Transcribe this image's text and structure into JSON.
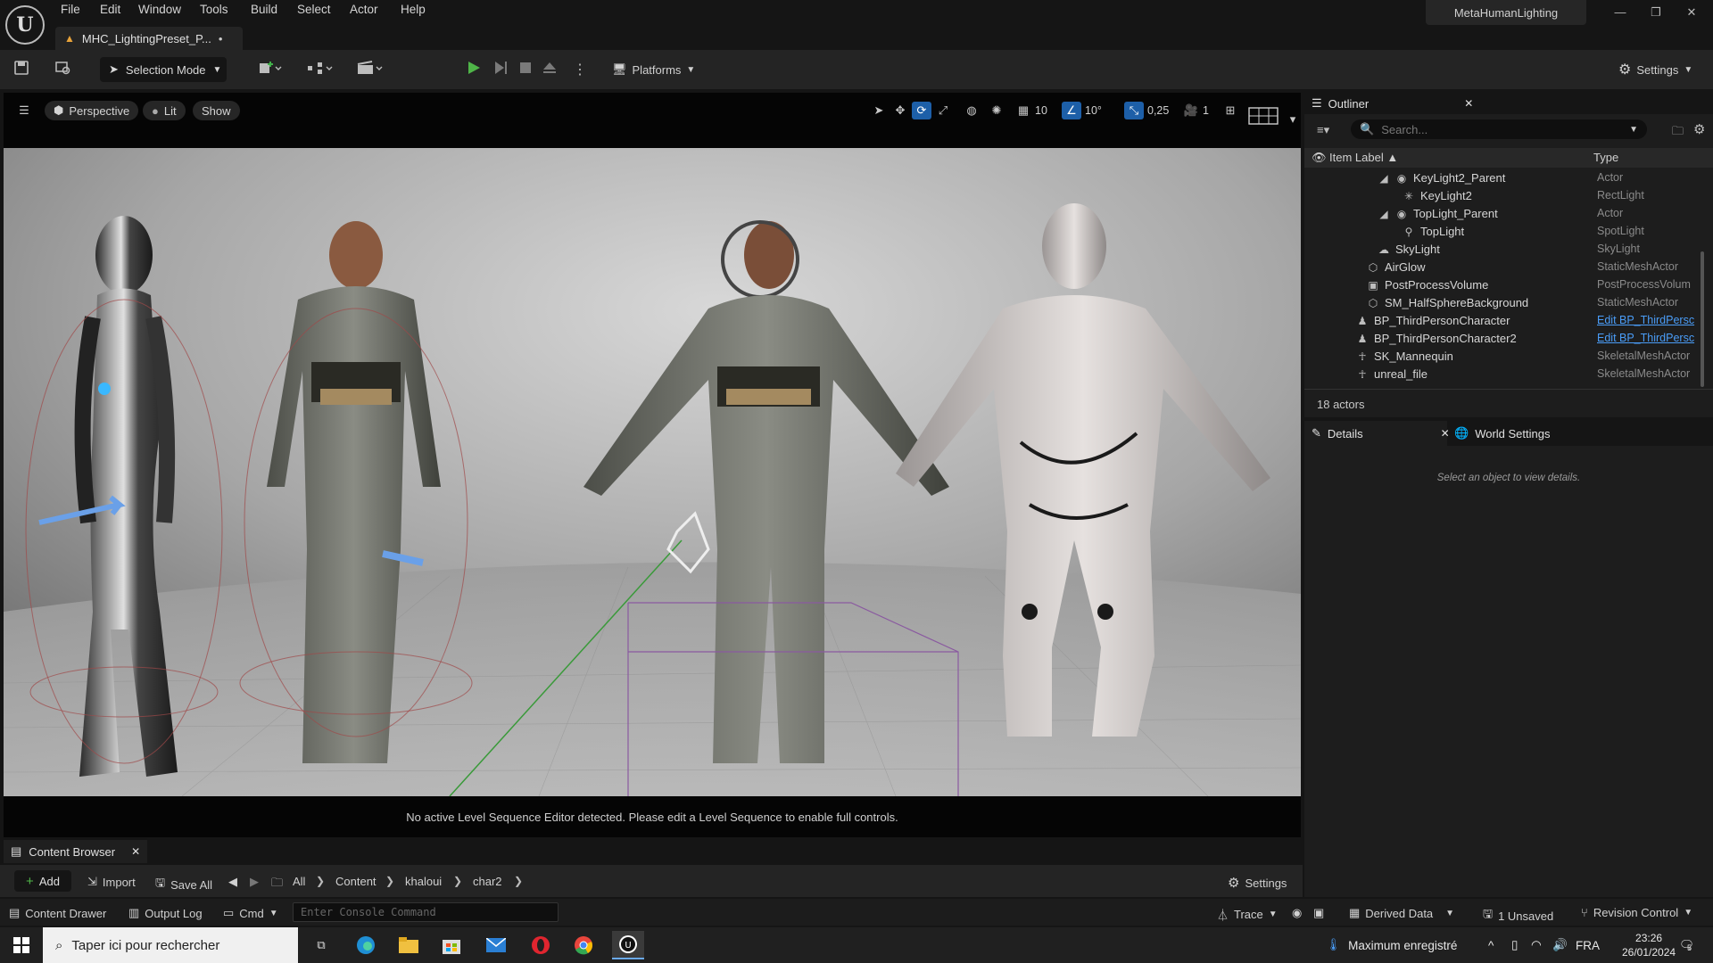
{
  "menu": [
    "File",
    "Edit",
    "Window",
    "Tools",
    "Build",
    "Select",
    "Actor",
    "Help"
  ],
  "doc_tab": {
    "title": "MHC_LightingPreset_P...",
    "modified_marker": "•"
  },
  "project_name": "MetaHumanLighting",
  "toolbar": {
    "selection_mode": "Selection Mode",
    "platforms": "Platforms",
    "settings": "Settings"
  },
  "viewport": {
    "perspective": "Perspective",
    "lit": "Lit",
    "show": "Show",
    "grid_snap": "10",
    "rotation_snap": "10°",
    "scale_snap": "0,25",
    "camera_speed": "1",
    "sequence_message": "No active Level Sequence Editor detected. Please edit a Level Sequence to enable full controls."
  },
  "outliner": {
    "title": "Outliner",
    "search_placeholder": "Search...",
    "col_label": "Item Label ▲",
    "col_type": "Type",
    "rows": [
      {
        "label": "KeyLight2_Parent",
        "type": "Actor"
      },
      {
        "label": "KeyLight2",
        "type": "RectLight"
      },
      {
        "label": "TopLight_Parent",
        "type": "Actor"
      },
      {
        "label": "TopLight",
        "type": "SpotLight"
      },
      {
        "label": "SkyLight",
        "type": "SkyLight"
      },
      {
        "label": "AirGlow",
        "type": "StaticMeshActor"
      },
      {
        "label": "PostProcessVolume",
        "type": "PostProcessVolum"
      },
      {
        "label": "SM_HalfSphereBackground",
        "type": "StaticMeshActor"
      },
      {
        "label": "BP_ThirdPersonCharacter",
        "type": "Edit BP_ThirdPersc"
      },
      {
        "label": "BP_ThirdPersonCharacter2",
        "type": "Edit BP_ThirdPersc"
      },
      {
        "label": "SK_Mannequin",
        "type": "SkeletalMeshActor"
      },
      {
        "label": "unreal_file",
        "type": "SkeletalMeshActor"
      }
    ],
    "count": "18 actors"
  },
  "details": {
    "title": "Details",
    "world_settings": "World Settings",
    "empty": "Select an object to view details."
  },
  "content_browser": {
    "tab": "Content Browser",
    "add": "Add",
    "import": "Import",
    "save_all": "Save All",
    "breadcrumbs": [
      "All",
      "Content",
      "khaloui",
      "char2"
    ],
    "settings": "Settings"
  },
  "statusbar": {
    "content_drawer": "Content Drawer",
    "output_log": "Output Log",
    "cmd": "Cmd",
    "console_placeholder": "Enter Console Command",
    "trace": "Trace",
    "derived_data": "Derived Data",
    "unsaved": "1 Unsaved",
    "revision_control": "Revision Control"
  },
  "taskbar": {
    "search_placeholder": "Taper ici pour rechercher",
    "weather": "Maximum enregistré",
    "lang": "FRA",
    "time": "23:26",
    "date": "26/01/2024",
    "notif_count": "5"
  }
}
